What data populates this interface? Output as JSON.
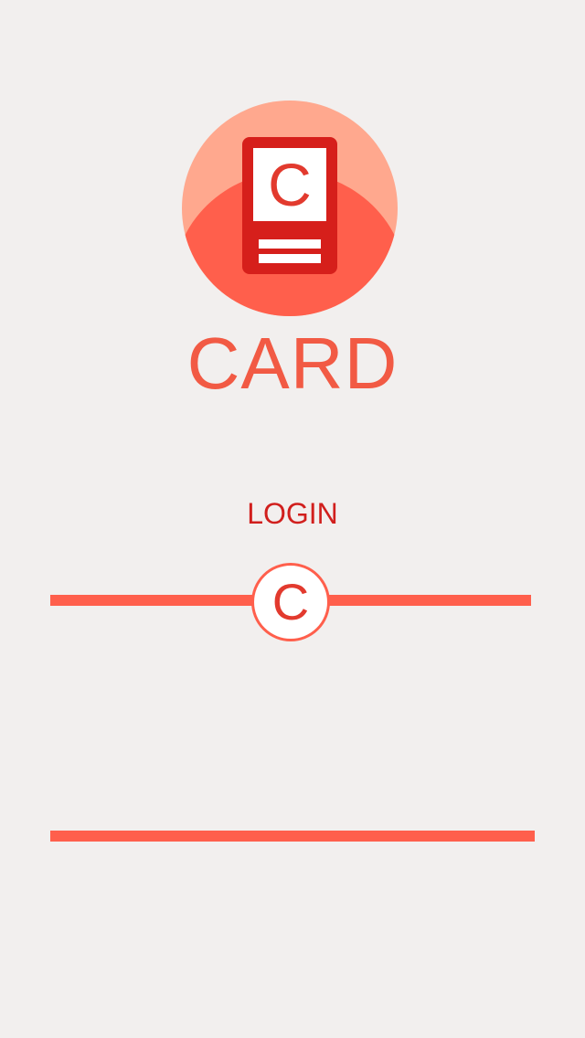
{
  "logo": {
    "icon_name": "card-icon",
    "letter": "C",
    "accent": "#ff5f4c",
    "dark_accent": "#d61f1b",
    "light_accent": "#ffa88e"
  },
  "brand": {
    "title": "CARD"
  },
  "login": {
    "label": "LOGIN",
    "slider_thumb_letter": "C",
    "slider_position": 0.5
  }
}
